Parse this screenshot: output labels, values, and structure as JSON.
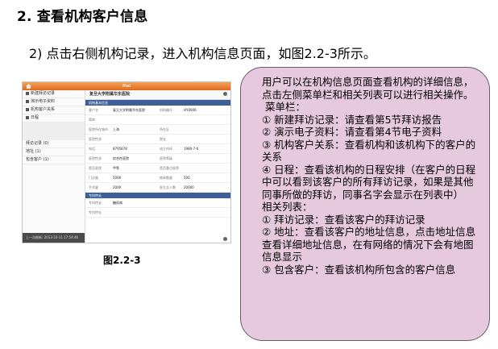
{
  "heading": "2. 查看机构客户信息",
  "intro": "2) 点击右侧机构记录，进入机构信息页面，如图2.2-3所示。",
  "screenshot": {
    "app_title": "iPad",
    "menu": [
      {
        "label": "新建拜访记录",
        "icon": "edit-icon"
      },
      {
        "label": "演示电子资料",
        "icon": "document-icon"
      },
      {
        "label": "机构客户关系",
        "icon": "network-icon"
      },
      {
        "label": "日程",
        "icon": "calendar-icon"
      }
    ],
    "lists": [
      "拜访记录 (0)",
      "地址 (1)",
      "包含客户 (1)"
    ],
    "footer": "上一次刷新: 2013-10-11 17:54:46",
    "page_title": "复旦大学附属华东医院",
    "section_basic": "机构基本信息",
    "section_special": "专科特长",
    "fields": [
      {
        "l1": "客户名",
        "v1": "复旦大学附属华东医院",
        "l2": "机构编号",
        "v2": "HY0006"
      },
      {
        "l1": "简称",
        "v1": "",
        "l2": "",
        "v2": ""
      },
      {
        "l1": "医院所在城市",
        "v1": "上海",
        "l2": "所在区",
        "v2": ""
      },
      {
        "l1": "医院性质",
        "v1": "",
        "l2": "院长",
        "v2": ""
      },
      {
        "l1": "电话",
        "v1": "8795878",
        "l2": "成立时间",
        "v2": "1980-7-6"
      },
      {
        "l1": "医院性质",
        "v1": "综合性医院",
        "l2": "医院等级",
        "v2": ""
      },
      {
        "l1": "是否医保",
        "v1": "甲等",
        "l2": "是否重点医院",
        "v2": ""
      },
      {
        "l1": "门诊量",
        "v1": "5000",
        "l2": "病床数量",
        "v2": "500"
      },
      {
        "l1": "手术量",
        "v1": "2000",
        "l2": "医生总人数",
        "v2": "20000"
      }
    ],
    "special_fields": [
      {
        "l1": "专科特长",
        "v1": "糖尿病"
      },
      {
        "l1": "专科特长",
        "v1": ""
      }
    ]
  },
  "caption": "图2.2-3",
  "note": [
    "用户可以在机构信息页面查看机构的详细信息，点击左侧菜单栏和相关列表可以进行相关操作。",
    "菜单栏：",
    "① 新建拜访记录：请查看第5节拜访报告",
    "② 演示电子资料：请查看第4节电子资料",
    "③ 机构客户关系：查看机构和该机构下的客户的关系",
    "④ 日程：查看该机构的日程安排（在客户的日程中可以看到该客户的所有拜访记录，如果是其他同事所做的拜访，同事名字会显示在列表中）",
    "相关列表：",
    "① 拜访记录：查看该客户的拜访记录",
    "② 地址：查看该客户的地址信息，点击地址信息查看详细地址信息，在有网络的情况下会有地图信息显示",
    "③ 包含客户：查看该机构所包含的客户信息"
  ]
}
